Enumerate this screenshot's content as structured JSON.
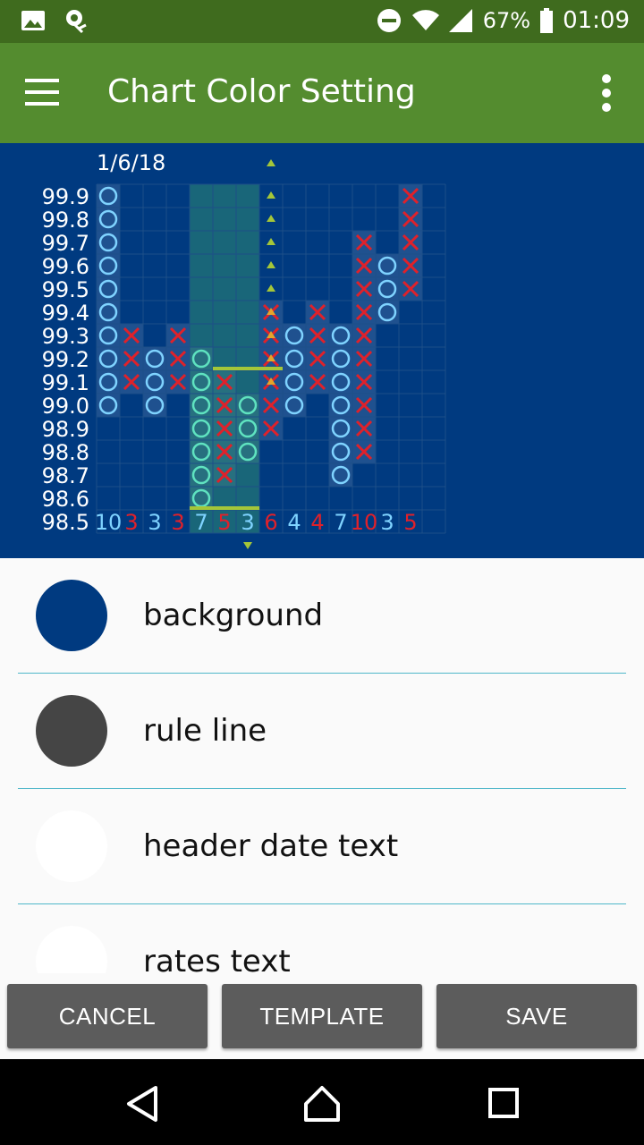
{
  "status_bar": {
    "battery": "67%",
    "time": "01:09"
  },
  "app_bar": {
    "title": "Chart Color Setting"
  },
  "chart": {
    "date": "1/6/18",
    "rates": [
      "99.9",
      "99.8",
      "99.7",
      "99.6",
      "99.5",
      "99.4",
      "99.3",
      "99.2",
      "99.1",
      "99.0",
      "98.9",
      "98.8",
      "98.7",
      "98.6",
      "98.5"
    ],
    "column_counts": [
      {
        "text": "10",
        "color": "#7fd3ff"
      },
      {
        "text": "3",
        "color": "#e0212a"
      },
      {
        "text": "3",
        "color": "#7fd3ff"
      },
      {
        "text": "3",
        "color": "#e0212a"
      },
      {
        "text": "7",
        "color": "#7fd3ff"
      },
      {
        "text": "5",
        "color": "#e0212a"
      },
      {
        "text": "3",
        "color": "#7fd3ff"
      },
      {
        "text": "6",
        "color": "#e0212a"
      },
      {
        "text": "4",
        "color": "#7fd3ff"
      },
      {
        "text": "4",
        "color": "#e0212a"
      },
      {
        "text": "7",
        "color": "#7fd3ff"
      },
      {
        "text": "10",
        "color": "#e0212a"
      },
      {
        "text": "3",
        "color": "#7fd3ff"
      },
      {
        "text": "5",
        "color": "#e0212a"
      }
    ],
    "columns": [
      {
        "mark": "O",
        "from": "99.0",
        "to": "99.9"
      },
      {
        "mark": "X",
        "from": "99.1",
        "to": "99.3"
      },
      {
        "mark": "O",
        "from": "99.0",
        "to": "99.2"
      },
      {
        "mark": "X",
        "from": "99.1",
        "to": "99.3"
      },
      {
        "mark": "O",
        "from": "98.6",
        "to": "99.2"
      },
      {
        "mark": "X",
        "from": "98.7",
        "to": "99.1"
      },
      {
        "mark": "O",
        "from": "98.8",
        "to": "99.0"
      },
      {
        "mark": "X",
        "from": "98.9",
        "to": "99.4"
      },
      {
        "mark": "O",
        "from": "99.0",
        "to": "99.3"
      },
      {
        "mark": "X",
        "from": "99.1",
        "to": "99.4"
      },
      {
        "mark": "O",
        "from": "98.7",
        "to": "99.3"
      },
      {
        "mark": "X",
        "from": "98.8",
        "to": "99.7"
      },
      {
        "mark": "O",
        "from": "99.4",
        "to": "99.6"
      },
      {
        "mark": "X",
        "from": "99.5",
        "to": "99.9"
      }
    ],
    "colors": {
      "background": "#003a80",
      "o_mark": "#7fd3ff",
      "o_mark_highlight": "#5fe3c0",
      "x_mark": "#e0212a",
      "highlight": "#2e8b72",
      "rule_line": "#1d4f88",
      "marker": "#a4c639"
    }
  },
  "settings": [
    {
      "label": "background",
      "color": "#003a80"
    },
    {
      "label": "rule line",
      "color": "#454545"
    },
    {
      "label": "header date text",
      "color": "#ffffff"
    },
    {
      "label": "rates text",
      "color": "#ffffff"
    }
  ],
  "buttons": {
    "cancel": "CANCEL",
    "template": "TEMPLATE",
    "save": "SAVE"
  }
}
